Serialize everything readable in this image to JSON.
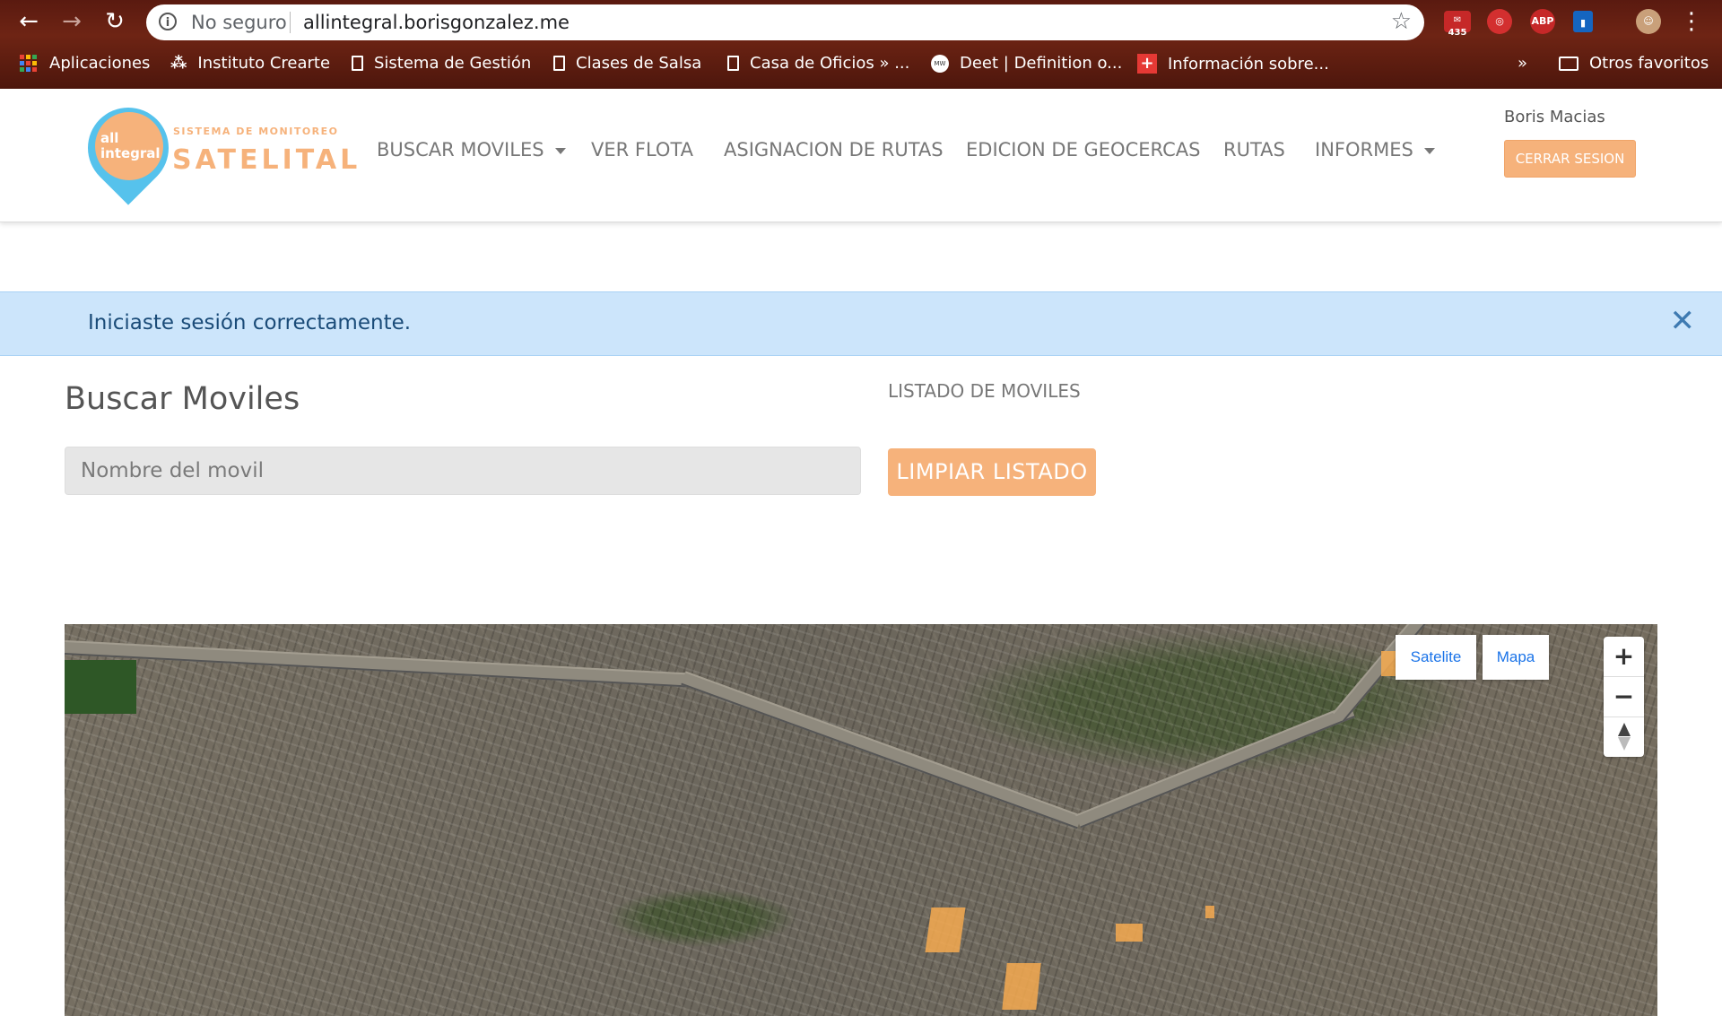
{
  "browser": {
    "security_label": "No seguro",
    "url": "allintegral.borisgonzalez.me",
    "mail_count": "435",
    "abp_label": "ABP",
    "bookmarks": [
      {
        "label": "Aplicaciones"
      },
      {
        "label": "Instituto Crearte"
      },
      {
        "label": "Sistema de Gestión"
      },
      {
        "label": "Clases de Salsa"
      },
      {
        "label": "Casa de Oficios » ..."
      },
      {
        "label": "Deet | Definition o..."
      },
      {
        "label": "Información sobre..."
      }
    ],
    "overflow_label": "»",
    "other_bookmarks": "Otros favoritos"
  },
  "navbar": {
    "logo_line1": "all",
    "logo_line2": "integral",
    "logo_small": "SISTEMA DE MONITOREO",
    "logo_big": "SATELITAL",
    "items": [
      {
        "label": "BUSCAR MOVILES"
      },
      {
        "label": "VER FLOTA"
      },
      {
        "label": "ASIGNACION DE RUTAS"
      },
      {
        "label": "EDICION DE GEOCERCAS"
      },
      {
        "label": "RUTAS"
      },
      {
        "label": "INFORMES"
      }
    ],
    "user_name": "Boris Macias",
    "logout_label": "CERRAR SESION"
  },
  "alert": {
    "message": "Iniciaste sesión correctamente.",
    "close_glyph": "✕"
  },
  "main": {
    "heading": "Buscar Moviles",
    "search_placeholder": "Nombre del movil",
    "list_title": "LISTADO DE MOVILES",
    "clear_label": "LIMPIAR LISTADO"
  },
  "map": {
    "type_satellite": "Satelite",
    "type_map": "Mapa",
    "zoom_in": "+",
    "zoom_out": "−",
    "geofence_color": "#f6aa50"
  },
  "colors": {
    "accent": "#f6b27b",
    "alert_bg": "#cce5fb",
    "logo_pin": "#56c2ec"
  }
}
